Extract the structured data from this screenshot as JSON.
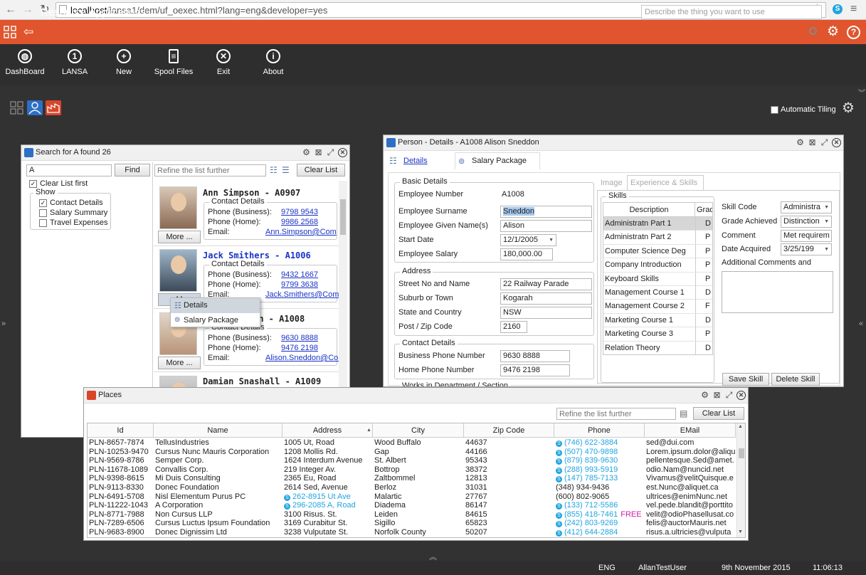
{
  "browser": {
    "url_host": "localhost",
    "url_rest": "/lansa1/dem/uf_oexec.html?lang=eng&developer=yes"
  },
  "header": {
    "title": "Resource Applications",
    "describe_placeholder": "Describe the thing you want to use"
  },
  "toolbar": {
    "items": [
      {
        "label": "DashBoard",
        "icon": "globe-icon"
      },
      {
        "label": "LANSA",
        "icon": "info-1-icon",
        "glyph": "1"
      },
      {
        "label": "New",
        "icon": "plus-icon",
        "glyph": "+"
      },
      {
        "label": "Spool Files",
        "icon": "document-icon",
        "glyph": "≡"
      },
      {
        "label": "Exit",
        "icon": "close-icon",
        "glyph": "✕"
      },
      {
        "label": "About",
        "icon": "info-icon",
        "glyph": "i"
      }
    ]
  },
  "tiling": {
    "label": "Automatic Tiling",
    "checked": false
  },
  "search_window": {
    "title": "Search for A found 26",
    "query": "A",
    "find_label": "Find",
    "refine_placeholder": "Refine the list further",
    "clear_label": "Clear List",
    "clear_first_label": "Clear List first",
    "show_legend": "Show",
    "show_options": [
      {
        "label": "Contact Details",
        "checked": true
      },
      {
        "label": "Salary Summary",
        "checked": false
      },
      {
        "label": "Travel Expenses",
        "checked": false
      }
    ],
    "people": [
      {
        "name": "Ann Simpson - A0907",
        "legend": "Contact Details",
        "phone_business_label": "Phone (Business):",
        "phone_business": "9798 9543",
        "phone_home_label": "Phone (Home):",
        "phone_home": "9986 2568",
        "email_label": "Email:",
        "email": "Ann.Simpson@Com",
        "more": "More ..."
      },
      {
        "name": "Jack Smithers - A1006",
        "legend": "Contact Details",
        "phone_business_label": "Phone (Business):",
        "phone_business": "9432 1667",
        "phone_home_label": "Phone (Home):",
        "phone_home": "9799 3638",
        "email_label": "Email:",
        "email": "Jack.Smithers@Com",
        "more": "M"
      },
      {
        "name": "on - A1008",
        "legend": "Contact Details",
        "phone_business_label": "Phone (Business):",
        "phone_business": "9630 8888",
        "phone_home_label": "Phone (Home):",
        "phone_home": "9476 2198",
        "email_label": "Email:",
        "email": "Alison.Sneddon@Com",
        "more": "More ..."
      },
      {
        "name": "Damian Snashall - A1009"
      }
    ],
    "context_menu": [
      {
        "label": "Details",
        "icon": "details-icon"
      },
      {
        "label": "Salary Package",
        "icon": "salary-icon"
      }
    ]
  },
  "person_window": {
    "title": "Person - Details - A1008 Alison Sneddon",
    "tabs": [
      {
        "label": "Details"
      },
      {
        "label": "Salary Package"
      }
    ],
    "basic": {
      "legend": "Basic Details",
      "employee_number_label": "Employee Number",
      "employee_number": "A1008",
      "surname_label": "Employee Surname",
      "surname": "Sneddon",
      "given_label": "Employee Given Name(s)",
      "given": "Alison",
      "start_label": "Start Date",
      "start": "12/1/2005",
      "salary_label": "Employee Salary",
      "salary": "180,000.00"
    },
    "address": {
      "legend": "Address",
      "street_label": "Street No and Name",
      "street": "22 Railway Parade",
      "suburb_label": "Suburb or Town",
      "suburb": "Kogarah",
      "state_label": "State and Country",
      "state": "NSW",
      "post_label": "Post / Zip Code",
      "post": "2160"
    },
    "contact": {
      "legend": "Contact Details",
      "business_label": "Business Phone Number",
      "business": "9630 8888",
      "home_label": "Home Phone Number",
      "home": "9476 2198"
    },
    "works_legend": "Works in Department / Section",
    "subtabs": [
      {
        "label": "Image"
      },
      {
        "label": "Experience & Skills"
      }
    ],
    "skills": {
      "legend": "Skills",
      "col_description": "Description",
      "col_grade": "Grad",
      "rows": [
        {
          "description": "Administratn Part 1",
          "grade": "D"
        },
        {
          "description": "Administratn Part 2",
          "grade": "P"
        },
        {
          "description": "Computer Science Deg",
          "grade": "P"
        },
        {
          "description": "Company Introduction",
          "grade": "P"
        },
        {
          "description": "Keyboard Skills",
          "grade": "P"
        },
        {
          "description": "Management Course 1",
          "grade": "D"
        },
        {
          "description": "Management Course 2",
          "grade": "F"
        },
        {
          "description": "Marketing Course 1",
          "grade": "D"
        },
        {
          "description": "Marketing Course 3",
          "grade": "P"
        },
        {
          "description": "Relation Theory",
          "grade": "D"
        }
      ],
      "skill_code_label": "Skill Code",
      "skill_code": "Administra",
      "grade_label": "Grade Achieved",
      "grade": "Distinction",
      "comment_label": "Comment",
      "comment": "Met requirem",
      "date_label": "Date Acquired",
      "date": "3/25/199",
      "additional_label": "Additional Comments and",
      "save_label": "Save Skill",
      "delete_label": "Delete Skill"
    }
  },
  "places_window": {
    "title": "Places",
    "refine_placeholder": "Refine the list further",
    "clear_label": "Clear List",
    "columns": [
      "Id",
      "Name",
      "Address",
      "City",
      "Zip Code",
      "Phone",
      "EMail"
    ],
    "rows": [
      [
        "PLN-8657-7874",
        "TellusIndustries",
        "1005 Ut, Road",
        "Wood Buffalo",
        "44637",
        "(746) 622-3884",
        "sed@dui.com"
      ],
      [
        "PLN-10253-9470",
        "Cursus Nunc Mauris Corporation",
        "1208 Mollis Rd.",
        "Gap",
        "44166",
        "(507) 470-9898",
        "Lorem.ipsum.dolor@aliqu"
      ],
      [
        "PLN-9569-8786",
        "Semper Corp.",
        "1624 Interdum Avenue",
        "St. Albert",
        "95343",
        "(879) 839-9630",
        "pellentesque.Sed@amet."
      ],
      [
        "PLN-11678-1089",
        "Convallis Corp.",
        "219 Integer Av.",
        "Bottrop",
        "38372",
        "(288) 993-5919",
        "odio.Nam@nuncid.net"
      ],
      [
        "PLN-9398-8615",
        "Mi Duis Consulting",
        "2365 Eu, Road",
        "Zaltbommel",
        "12813",
        "(147) 785-7133",
        "Vivamus@velitQuisque.e"
      ],
      [
        "PLN-9113-8330",
        "Donec Foundation",
        "2614 Sed, Avenue",
        "Berloz",
        "31031",
        "(348) 934-9436",
        "est.Nunc@aliquet.ca"
      ],
      [
        "PLN-6491-5708",
        "Nisl Elementum Purus PC",
        "262-8915 Ut Ave",
        "Malartic",
        "27767",
        "(600) 802-9065",
        "ultrices@enimNunc.net"
      ],
      [
        "PLN-11222-1043",
        "A Corporation",
        "296-2085 A, Road",
        "Diadema",
        "86147",
        "(133) 712-5586",
        "vel.pede.blandit@porttito"
      ],
      [
        "PLN-8771-7988",
        "Non Cursus LLP",
        "3100 Risus. St.",
        "Leiden",
        "84615",
        "(855) 418-7461",
        "velit@odioPhasellusat.co"
      ],
      [
        "PLN-7289-6506",
        "Cursus Luctus Ipsum Foundation",
        "3169 Curabitur St.",
        "Sigillo",
        "65823",
        "(242) 803-9269",
        "felis@auctorMauris.net"
      ],
      [
        "PLN-9683-8900",
        "Donec Dignissim Ltd",
        "3238 Vulputate St.",
        "Norfolk County",
        "50207",
        "(412) 644-2884",
        "risus.a.ultricies@vulputa"
      ]
    ],
    "free_label": "FREE"
  },
  "status": {
    "language": "ENG",
    "user": "AllanTestUser",
    "date": "9th November 2015",
    "time": "11:06:13"
  },
  "colors": {
    "accent": "#e0552d",
    "link": "#1a33c6",
    "skype": "#20a4e0",
    "app_background": "#323232"
  }
}
